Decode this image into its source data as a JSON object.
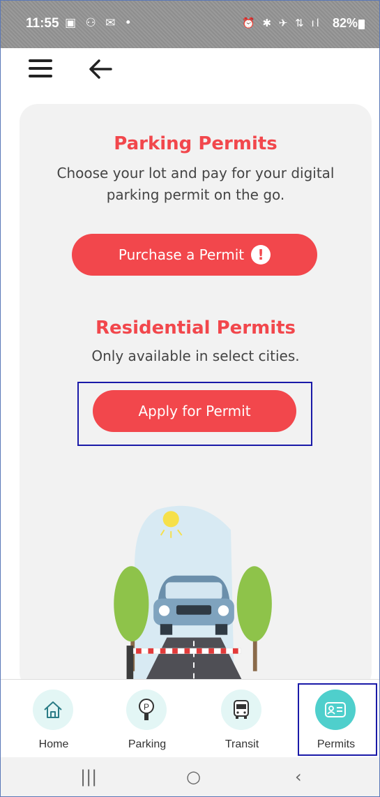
{
  "status_bar": {
    "time": "11:55",
    "left_icons": "▣ ⚇ ✉ •",
    "right_icons": "⏰ ✱ ✈ ⇅ ıl",
    "battery": "82%"
  },
  "header": {
    "menu_icon": "hamburger-menu-icon",
    "back_icon": "arrow-left-icon"
  },
  "parking_section": {
    "title": "Parking Permits",
    "description": "Choose your lot and pay for your digital parking permit on the go.",
    "button_label": "Purchase a Permit",
    "button_icon": "!"
  },
  "residential_section": {
    "title": "Residential Permits",
    "description": "Only available in select cities.",
    "button_label": "Apply for Permit"
  },
  "bottom_nav": {
    "items": [
      {
        "label": "Home",
        "icon": "home-icon",
        "active": false
      },
      {
        "label": "Parking",
        "icon": "parking-meter-icon",
        "active": false
      },
      {
        "label": "Transit",
        "icon": "bus-icon",
        "active": false
      },
      {
        "label": "Permits",
        "icon": "permit-card-icon",
        "active": true
      }
    ]
  },
  "system_nav": {
    "recents": "|||",
    "home": "○",
    "back": "‹"
  },
  "colors": {
    "accent_red": "#f2474c",
    "active_teal": "#4fcfcc",
    "highlight_blue": "#1a1aa8"
  }
}
